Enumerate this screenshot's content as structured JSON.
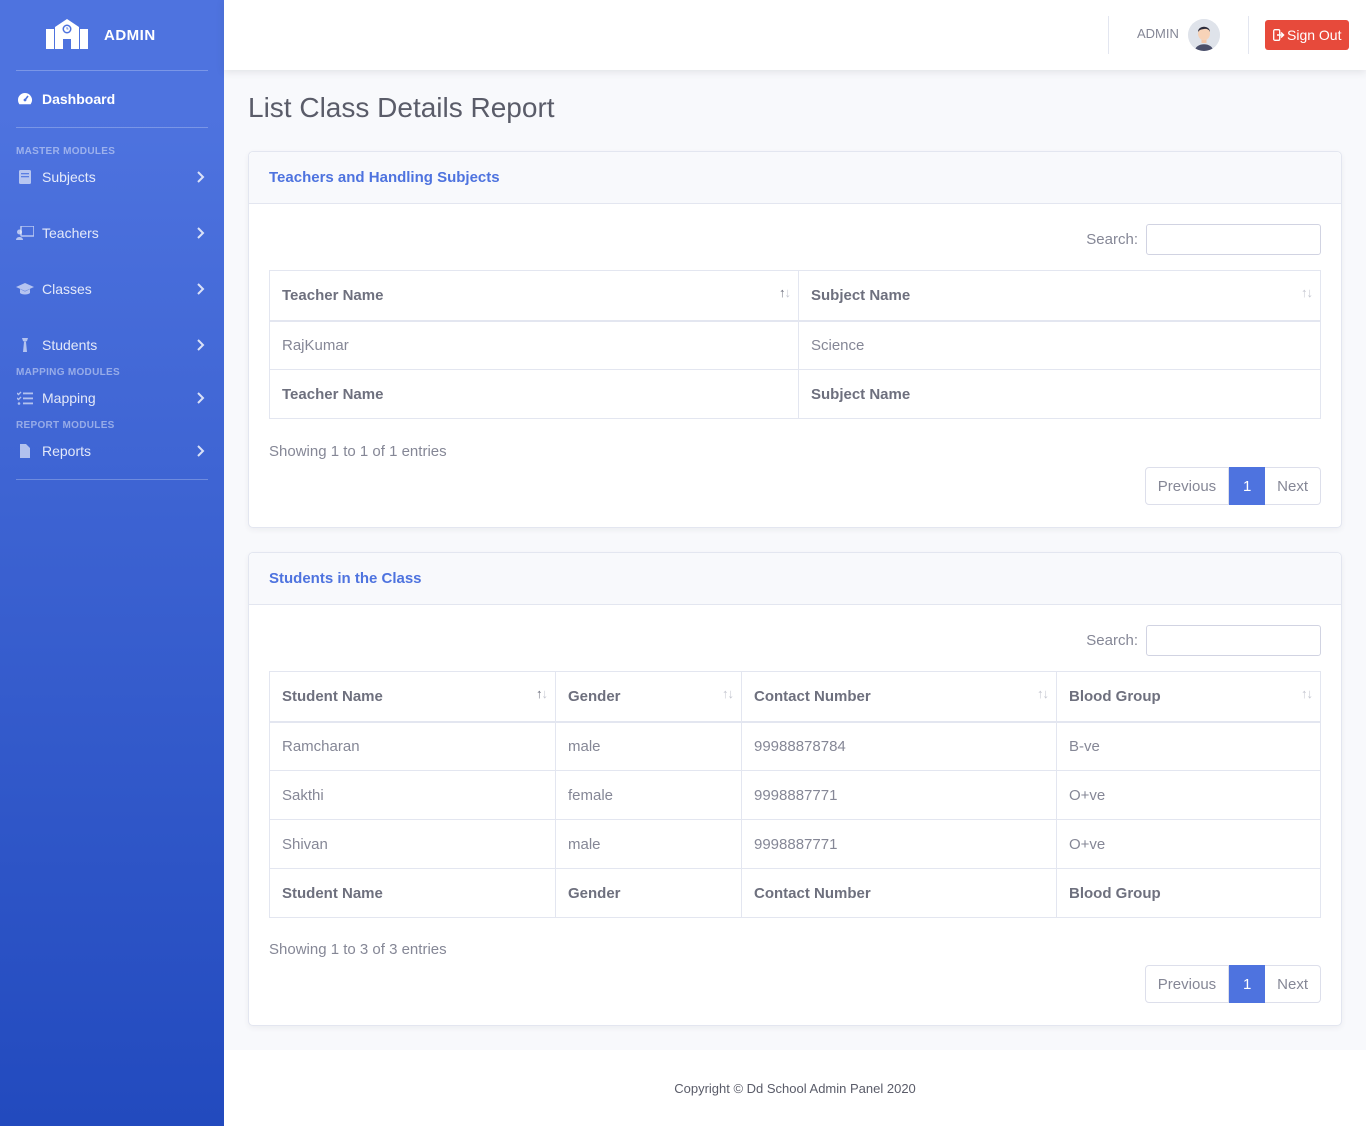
{
  "brand": {
    "title": "ADMIN"
  },
  "sidebar": {
    "dashboard": "Dashboard",
    "headings": {
      "master": "MASTER MODULES",
      "mapping": "MAPPING MODULES",
      "report": "REPORT MODULES"
    },
    "items": [
      {
        "label": "Subjects",
        "icon": "book-icon"
      },
      {
        "label": "Teachers",
        "icon": "chalkboard-teacher-icon"
      },
      {
        "label": "Classes",
        "icon": "graduation-cap-icon"
      },
      {
        "label": "Students",
        "icon": "user-tie-icon"
      },
      {
        "label": "Mapping",
        "icon": "tasks-icon"
      },
      {
        "label": "Reports",
        "icon": "file-icon"
      }
    ]
  },
  "topbar": {
    "user": "ADMIN",
    "signout": "Sign Out"
  },
  "page": {
    "title": "List Class Details Report"
  },
  "teachers_card": {
    "title": "Teachers and Handling Subjects",
    "search_label": "Search:",
    "columns": [
      "Teacher Name",
      "Subject Name"
    ],
    "rows": [
      [
        "RajKumar",
        "Science"
      ]
    ],
    "info": "Showing 1 to 1 of 1 entries",
    "pager": {
      "prev": "Previous",
      "current": "1",
      "next": "Next"
    }
  },
  "students_card": {
    "title": "Students in the Class",
    "search_label": "Search:",
    "columns": [
      "Student Name",
      "Gender",
      "Contact Number",
      "Blood Group"
    ],
    "rows": [
      [
        "Ramcharan",
        "male",
        "99988878784",
        "B-ve"
      ],
      [
        "Sakthi",
        "female",
        "9998887771",
        "O+ve"
      ],
      [
        "Shivan",
        "male",
        "9998887771",
        "O+ve"
      ]
    ],
    "info": "Showing 1 to 3 of 3 entries",
    "pager": {
      "prev": "Previous",
      "current": "1",
      "next": "Next"
    }
  },
  "footer": {
    "text": "Copyright © Dd School Admin Panel 2020"
  },
  "colors": {
    "primary": "#4e73df",
    "danger": "#e74a3b",
    "sidebar_bottom": "#224abe"
  }
}
